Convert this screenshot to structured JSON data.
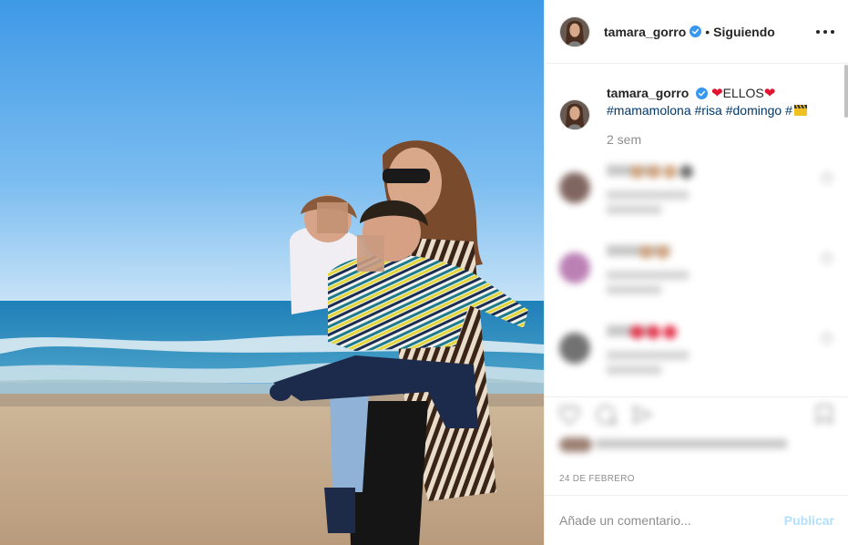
{
  "post": {
    "username": "tamara_gorro",
    "verified": true,
    "separator": "•",
    "follow_label": "Siguiendo",
    "more_icon": "more-dots-icon"
  },
  "caption": {
    "username": "tamara_gorro",
    "heart": "❤",
    "text": "ELLOS",
    "heart2": "❤",
    "tags": "#mamamolona #risa #domingo #",
    "emoji": "clapper-board",
    "ago": "2 sem"
  },
  "comments": [
    {
      "user": "",
      "meta": "",
      "reply": "",
      "colors": [
        "#c9956a",
        "#c9956a",
        "#c9956a",
        "#555555"
      ]
    },
    {
      "user": "",
      "meta": "",
      "reply": "",
      "colors": [
        "#c9956a",
        "#c9956a"
      ]
    },
    {
      "user": "",
      "meta": "",
      "reply": "",
      "colors": [
        "#e0142e",
        "#e0142e",
        "#e0142e"
      ]
    }
  ],
  "actions": {
    "like_icon": "heart-outline-icon",
    "comment_icon": "comment-icon",
    "share_icon": "share-icon",
    "save_icon": "bookmark-icon",
    "likes_text": "",
    "date": "24 DE FEBRERO"
  },
  "composer": {
    "placeholder": "Añade un comentario...",
    "publish": "Publicar"
  },
  "colors": {
    "link": "#00376b",
    "muted": "#8e8e8e",
    "verified": "#3897f0",
    "publish_disabled": "#b2dffc",
    "heart": "#e0142e"
  }
}
